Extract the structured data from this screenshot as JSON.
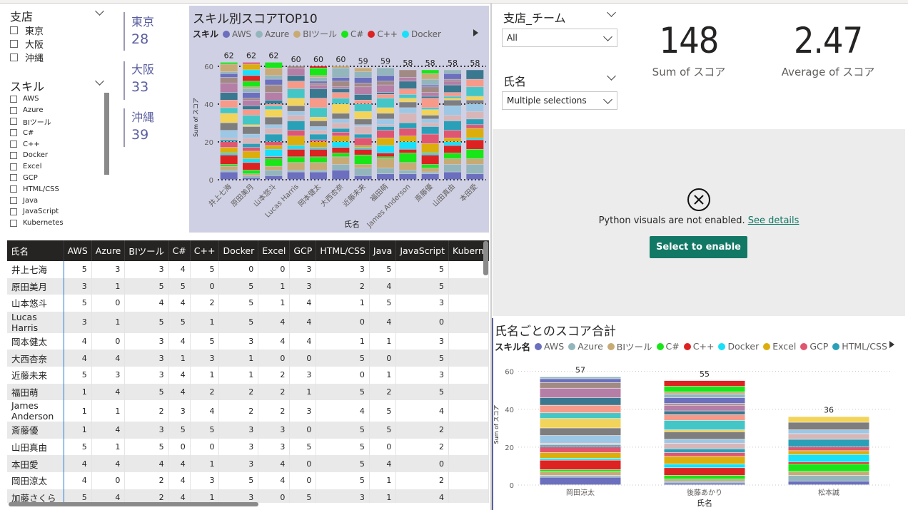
{
  "branch_slicer": {
    "title": "支店",
    "items": [
      "東京",
      "大阪",
      "沖縄"
    ]
  },
  "skill_slicer": {
    "title": "スキル",
    "items": [
      "AWS",
      "Azure",
      "BIツール",
      "C#",
      "C++",
      "Docker",
      "Excel",
      "GCP",
      "HTML/CSS",
      "Java",
      "JavaScript",
      "Kubernetes"
    ]
  },
  "branch_cards": [
    {
      "label": "東京",
      "value": "28"
    },
    {
      "label": "大阪",
      "value": "33"
    },
    {
      "label": "沖縄",
      "value": "39"
    }
  ],
  "colors": {
    "AWS": "#6b6fbd",
    "Azure": "#93b6bc",
    "BIツール": "#c8ab74",
    "C#": "#18e618",
    "C++": "#dd2222",
    "Docker": "#18e0f8",
    "Excel": "#dcae0c",
    "GCP": "#e05570",
    "HTML/CSS": "#2aa0b8",
    "Java": "#d8b6b8",
    "JavaScript": "#9cc8e6",
    "Kubernetes": "#7e7e7e",
    "s13": "#f2d45a",
    "s14": "#45c6c6",
    "s15": "#f79a8a",
    "s16": "#3a7890",
    "s17": "#b57ea6",
    "s18": "#a28a84",
    "chart_bg": "#cfd0e3",
    "header_bg": "#252423",
    "accent": "#117865",
    "card_text": "#5b5fa0"
  },
  "top_chart": {
    "title": "スキル別スコアTOP10",
    "legend_title": "スキル",
    "legend_items": [
      "AWS",
      "Azure",
      "BIツール",
      "C#",
      "C++",
      "Docker"
    ],
    "xlabel": "氏名",
    "ylabel": "Sum of スコア",
    "yticks": [
      "0",
      "20",
      "40",
      "60"
    ]
  },
  "chart_data": [
    {
      "type": "bar",
      "stacked": true,
      "title": "スキル別スコアTOP10",
      "xlabel": "氏名",
      "ylabel": "Sum of スコア",
      "ylim": [
        0,
        66
      ],
      "categories": [
        "井上七海",
        "原田美月",
        "山本悠斗",
        "Lucas Harris",
        "岡本健太",
        "大西杏奈",
        "近藤未来",
        "福田萌",
        "James Anderson",
        "斎藤優",
        "山田真由",
        "本田愛"
      ],
      "values": [
        62,
        62,
        62,
        60,
        60,
        60,
        59,
        59,
        58,
        58,
        58,
        58
      ]
    },
    {
      "type": "bar",
      "stacked": true,
      "title": "氏名ごとのスコア合計",
      "xlabel": "氏名",
      "ylabel": "Sum of スコア",
      "ylim": [
        0,
        64
      ],
      "categories": [
        "岡田涼太",
        "後藤あかり",
        "松本誠"
      ],
      "values": [
        57,
        55,
        36
      ]
    }
  ],
  "table": {
    "columns": [
      "氏名",
      "AWS",
      "Azure",
      "BIツール",
      "C#",
      "C++",
      "Docker",
      "Excel",
      "GCP",
      "HTML/CSS",
      "Java",
      "JavaScript",
      "Kubern"
    ],
    "rows": [
      [
        "井上七海",
        "5",
        "3",
        "3",
        "4",
        "5",
        "0",
        "0",
        "3",
        "3",
        "5",
        "5",
        ""
      ],
      [
        "原田美月",
        "3",
        "1",
        "5",
        "5",
        "0",
        "5",
        "1",
        "3",
        "2",
        "4",
        "5",
        ""
      ],
      [
        "山本悠斗",
        "5",
        "0",
        "4",
        "4",
        "2",
        "5",
        "1",
        "4",
        "1",
        "5",
        "3",
        ""
      ],
      [
        "Lucas Harris",
        "3",
        "1",
        "5",
        "5",
        "1",
        "5",
        "4",
        "4",
        "0",
        "4",
        "0",
        ""
      ],
      [
        "岡本健太",
        "4",
        "0",
        "3",
        "4",
        "5",
        "3",
        "4",
        "4",
        "1",
        "1",
        "3",
        ""
      ],
      [
        "大西杏奈",
        "4",
        "4",
        "3",
        "1",
        "3",
        "1",
        "0",
        "0",
        "5",
        "0",
        "5",
        ""
      ],
      [
        "近藤未来",
        "5",
        "3",
        "3",
        "4",
        "1",
        "1",
        "2",
        "3",
        "0",
        "1",
        "3",
        ""
      ],
      [
        "福田萌",
        "1",
        "4",
        "5",
        "4",
        "2",
        "2",
        "2",
        "1",
        "5",
        "2",
        "5",
        ""
      ],
      [
        "James Anderson",
        "1",
        "1",
        "2",
        "3",
        "4",
        "2",
        "2",
        "3",
        "4",
        "5",
        "4",
        ""
      ],
      [
        "斎藤優",
        "1",
        "4",
        "3",
        "5",
        "5",
        "3",
        "3",
        "0",
        "5",
        "5",
        "2",
        ""
      ],
      [
        "山田真由",
        "5",
        "1",
        "5",
        "0",
        "0",
        "3",
        "3",
        "5",
        "5",
        "0",
        "2",
        ""
      ],
      [
        "本田愛",
        "4",
        "4",
        "4",
        "4",
        "1",
        "3",
        "4",
        "0",
        "5",
        "4",
        "0",
        ""
      ],
      [
        "岡田涼太",
        "4",
        "0",
        "2",
        "4",
        "3",
        "5",
        "4",
        "0",
        "5",
        "1",
        "2",
        ""
      ],
      [
        "加藤さくら",
        "5",
        "4",
        "2",
        "4",
        "1",
        "3",
        "0",
        "5",
        "3",
        "1",
        "4",
        ""
      ]
    ]
  },
  "team_slicer": {
    "title": "支店_チーム",
    "value": "All"
  },
  "name_slicer": {
    "title": "氏名",
    "value": "Multiple selections"
  },
  "kpi": [
    {
      "value": "148",
      "label": "Sum of スコア"
    },
    {
      "value": "2.47",
      "label": "Average of スコア"
    }
  ],
  "python_visual": {
    "message": "Python visuals are not enabled.",
    "link": "See details",
    "button": "Select to enable"
  },
  "bottom_chart": {
    "title": "氏名ごとのスコア合計",
    "legend_title": "スキル名",
    "legend_items": [
      "AWS",
      "Azure",
      "BIツール",
      "C#",
      "C++",
      "Docker",
      "Excel",
      "GCP",
      "HTML/CSS"
    ],
    "xlabel": "氏名",
    "ylabel": "Sum of スコア",
    "yticks": [
      "0",
      "20",
      "40",
      "60"
    ]
  }
}
